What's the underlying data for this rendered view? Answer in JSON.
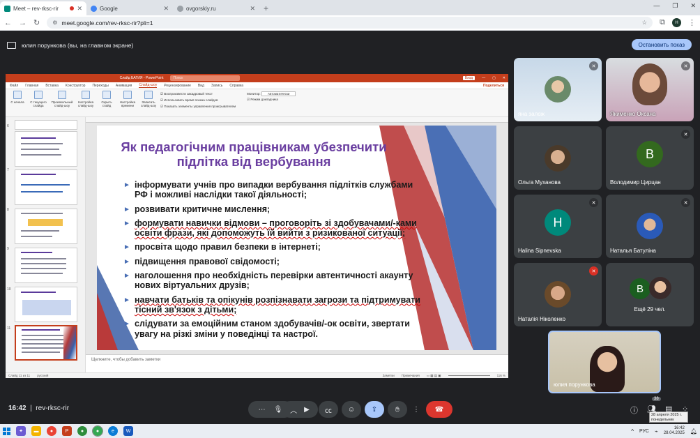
{
  "browser": {
    "tabs": [
      {
        "title": "Meet – rev-rksc-rir",
        "active": true,
        "color": "#00897b"
      },
      {
        "title": "Google",
        "active": false,
        "color": "#4285f4"
      },
      {
        "title": "ovgorskiy.ru",
        "active": false,
        "color": "#5f6368"
      }
    ],
    "url": "meet.google.com/rev-rksc-rir?pli=1",
    "profile": "Н"
  },
  "meet": {
    "presenting_banner": "юлия порункова (вы, на главном экране)",
    "stop_button": "Остановить показ",
    "meeting_clock": "16:42",
    "meeting_code": "rev-rksc-rir",
    "participant_count": "38",
    "tiles": [
      {
        "name": "яна залож",
        "type": "photo"
      },
      {
        "name": "Якименко Оксана",
        "type": "photo"
      },
      {
        "name": "Ольга Муханова",
        "type": "photo"
      },
      {
        "name": "Володимир Цирцан",
        "letter": "В",
        "bg": "#33691e"
      },
      {
        "name": "Halina Sipnevska",
        "letter": "H",
        "bg": "#00897b"
      },
      {
        "name": "Наталья Батуліна",
        "type": "photo"
      },
      {
        "name": "Наталія Ніколенко",
        "type": "photo"
      },
      {
        "name": "Ещё 29 чел.",
        "letter": "В",
        "bg": "#1b5e20"
      }
    ],
    "self_tile": "юлия порункова"
  },
  "ppt": {
    "title": "Слайд БАГИЯ - PowerPoint",
    "search_placeholder": "Поиск",
    "tabs": [
      "Файл",
      "Главная",
      "Вставка",
      "Конструктор",
      "Переходы",
      "Анимация",
      "Слайд-шоу",
      "Рецензирование",
      "Вид",
      "Запись",
      "Справка"
    ],
    "active_tab": "Слайд-шоу",
    "ribbon": [
      "С начала",
      "С текущего слайда",
      "Произвольный слайд-шоу",
      "Настройка слайд-шоу",
      "Скрыть слайд",
      "Настройка времени",
      "Записать слайд-шоу"
    ],
    "checks": [
      "Воспроизвести закадровый текст",
      "Использовать время показа слайдов",
      "Показать элементы управления проигрывателем"
    ],
    "monitor_label": "Монитор:",
    "monitor_value": "Автоматически",
    "presenter_view": "Режим докладчика",
    "share_label": "Поделиться",
    "slide_numbers": [
      "6",
      "7",
      "8",
      "9",
      "10",
      "11"
    ],
    "notes_placeholder": "Щелкните, чтобы добавить заметки",
    "status_left": "Слайд 11 из 11",
    "status_lang": "русский",
    "status_notes": "Заметки",
    "status_comments": "Примечания",
    "zoom": "116 %"
  },
  "slide": {
    "title": "Як педагогічним працівникам убезпечити підлітка від вербування",
    "bullets": [
      "інформувати учнів про випадки вербування підлітків службами РФ і можливі наслідки такої діяльності;",
      "розвивати критичне мислення;",
      "формувати навички відмови – проговоріть зі здобувачами/-ками освіти фрази, які допоможуть їй вийти з ризикованої ситуації;",
      "просвіта щодо правил безпеки в інтернеті;",
      "підвищення правової свідомості;",
      "наголошення про необхідність перевірки автентичності акаунту нових віртуальних друзів;",
      "навчати батьків та опікунів розпізнавати загрози та підтримувати тісний зв'язок з дітьми;",
      "слідувати за емоційним станом здобувачів/-ок освіти, звертати увагу на різкі зміни у поведінці та настрої."
    ]
  },
  "taskbar": {
    "lang": "РУС",
    "time": "16:42",
    "date": "28.04.2025",
    "tooltip": "28 апреля 2025 г. понедельник"
  }
}
